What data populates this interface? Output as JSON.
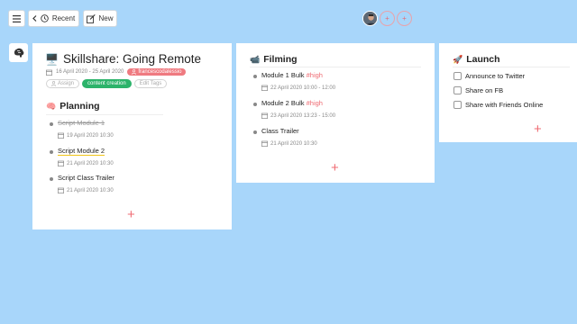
{
  "toolbar": {
    "recent_label": "Recent",
    "new_label": "New"
  },
  "collaborators": {
    "add_label_1": "+",
    "add_label_2": "+"
  },
  "boards": {
    "planning": {
      "emoji": "🖥️",
      "title": "Skillshare: Going Remote",
      "date_range": "16 April 2020 - 25 April 2020",
      "owner": "francescodalessio",
      "tags": [
        "Assign",
        "content creation",
        "Edit Tags"
      ],
      "list_title": "Planning",
      "list_emoji": "🧠",
      "tasks": [
        {
          "title": "Script Module 1",
          "date": "19 April 2020 10:30",
          "done": true
        },
        {
          "title": "Script Module 2",
          "date": "21 April 2020 10:30",
          "done": false
        },
        {
          "title": "Script Class Trailer",
          "date": "21 April 2020 10:30",
          "done": false
        }
      ],
      "add_label": "+"
    },
    "filming": {
      "list_emoji": "📹",
      "list_title": "Filming",
      "tasks": [
        {
          "title": "Module 1 Bulk",
          "priority": "#high",
          "date": "22 April 2020 10:00 - 12:00"
        },
        {
          "title": "Module 2 Bulk",
          "priority": "#high",
          "date": "23 April 2020 13:23 - 15:00"
        },
        {
          "title": "Class Trailer",
          "priority": "",
          "date": "21 April 2020 10:30"
        }
      ],
      "add_label": "+"
    },
    "launch": {
      "list_emoji": "🚀",
      "list_title": "Launch",
      "items": [
        "Announce to Twitter",
        "Share on FB",
        "Share with Friends Online"
      ],
      "add_label": "+"
    }
  },
  "colors": {
    "background": "#a8d6fa",
    "accent_red": "#ef6b73",
    "tag_green": "#2cb36a",
    "underline_yellow": "#f0c419"
  }
}
